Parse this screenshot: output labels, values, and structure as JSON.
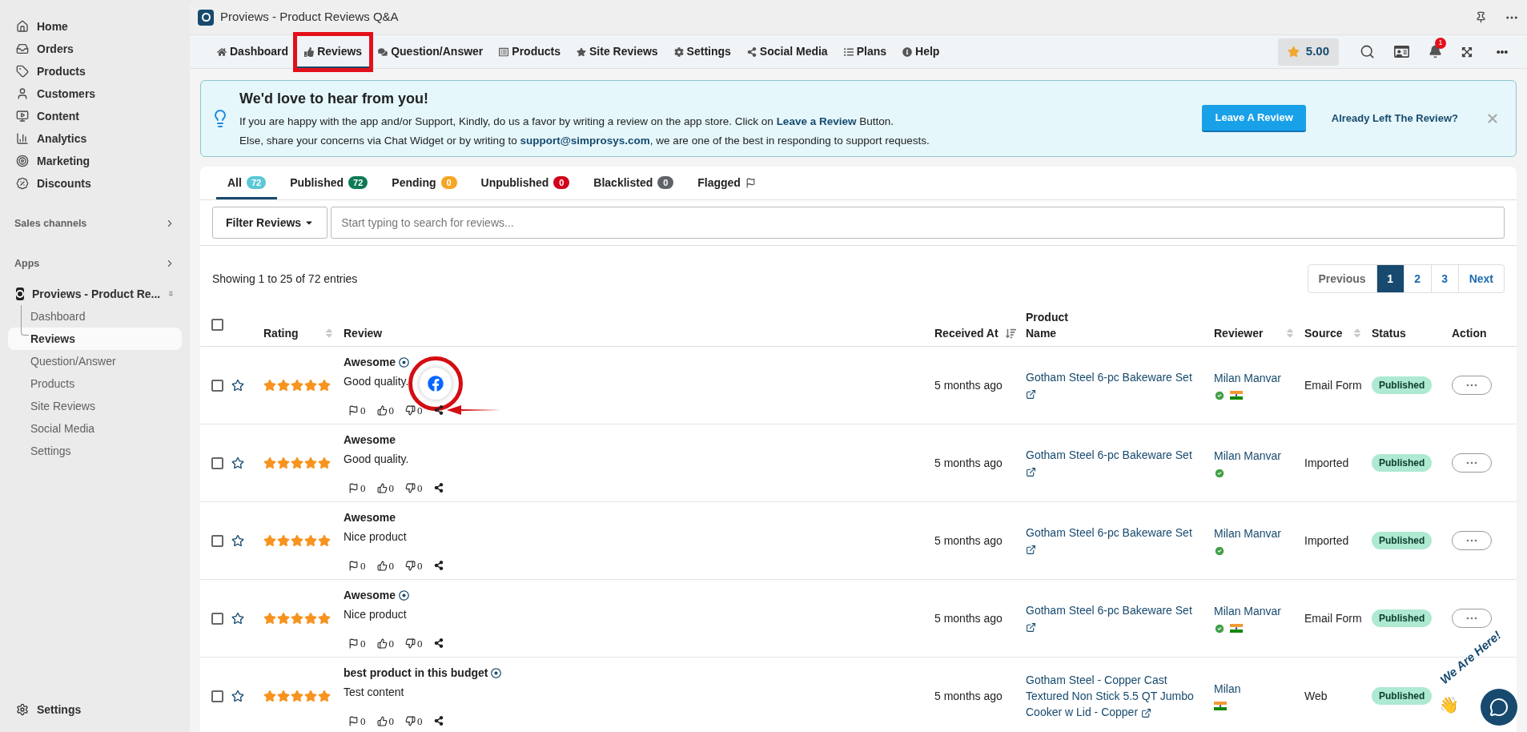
{
  "sidebar": {
    "items": [
      {
        "label": "Home"
      },
      {
        "label": "Orders"
      },
      {
        "label": "Products"
      },
      {
        "label": "Customers"
      },
      {
        "label": "Content"
      },
      {
        "label": "Analytics"
      },
      {
        "label": "Marketing"
      },
      {
        "label": "Discounts"
      }
    ],
    "sections": [
      {
        "label": "Sales channels"
      },
      {
        "label": "Apps"
      }
    ],
    "app": {
      "label": "Proviews - Product Re...",
      "children": [
        {
          "label": "Dashboard",
          "selected": false
        },
        {
          "label": "Reviews",
          "selected": true
        },
        {
          "label": "Question/Answer",
          "selected": false
        },
        {
          "label": "Products",
          "selected": false
        },
        {
          "label": "Site Reviews",
          "selected": false
        },
        {
          "label": "Social Media",
          "selected": false
        },
        {
          "label": "Settings",
          "selected": false
        }
      ]
    },
    "footer": {
      "label": "Settings"
    }
  },
  "window": {
    "title": "Proviews - Product Reviews Q&A"
  },
  "nav": {
    "tabs": [
      {
        "label": "Dashboard",
        "selected": false,
        "annotated": false
      },
      {
        "label": "Reviews",
        "selected": true,
        "annotated": true
      },
      {
        "label": "Question/Answer",
        "selected": false,
        "annotated": false
      },
      {
        "label": "Products",
        "selected": false,
        "annotated": false
      },
      {
        "label": "Site Reviews",
        "selected": false,
        "annotated": false
      },
      {
        "label": "Settings",
        "selected": false,
        "annotated": false
      },
      {
        "label": "Social Media",
        "selected": false,
        "annotated": false
      },
      {
        "label": "Plans",
        "selected": false,
        "annotated": false
      },
      {
        "label": "Help",
        "selected": false,
        "annotated": false
      }
    ],
    "rating": "5.00",
    "notifications": "1"
  },
  "banner": {
    "title": "We'd love to hear from you!",
    "lines": [
      "If you are happy with the app and/or Support, Kindly, do us a favor by writing a review on the app store. Click on **Leave a Review** Button.",
      "Else, share your concerns via Chat Widget or by writing to **support@simprosys.com**, we are one of the best in responding to support requests."
    ],
    "button": "Leave A Review",
    "link": "Already Left The Review?"
  },
  "status_tabs": [
    {
      "label": "All",
      "count": "72",
      "color": "#5bc8d6",
      "selected": true
    },
    {
      "label": "Published",
      "count": "72",
      "color": "#0f7a57",
      "selected": false
    },
    {
      "label": "Pending",
      "count": "0",
      "color": "#f5a623",
      "selected": false
    },
    {
      "label": "Unpublished",
      "count": "0",
      "color": "#d0021b",
      "selected": false
    },
    {
      "label": "Blacklisted",
      "count": "0",
      "color": "#5f6368",
      "selected": false
    },
    {
      "label": "Flagged",
      "selected": false
    }
  ],
  "filter": {
    "button": "Filter Reviews",
    "placeholder": "Start typing to search for reviews..."
  },
  "summary": "Showing 1 to 25 of 72 entries",
  "pagination": {
    "previous": "Previous",
    "next": "Next",
    "pages": [
      {
        "label": "1",
        "selected": true
      },
      {
        "label": "2",
        "selected": false
      },
      {
        "label": "3",
        "selected": false
      }
    ]
  },
  "table": {
    "select_all": {
      "checked": false
    },
    "columns": [
      {
        "label": "Rating",
        "sortable": true,
        "sorted": false
      },
      {
        "label": "Review",
        "sortable": false
      },
      {
        "label": "Received At",
        "sortable": true,
        "sorted": true
      },
      {
        "label": "Product Name",
        "sortable": false
      },
      {
        "label": "Reviewer",
        "sortable": true,
        "sorted": false
      },
      {
        "label": "Source",
        "sortable": true,
        "sorted": false
      },
      {
        "label": "Status",
        "sortable": false
      },
      {
        "label": "Action",
        "sortable": false
      }
    ],
    "rows": [
      {
        "checked": false,
        "favorite": false,
        "stars": 5,
        "title": "Awesome",
        "verified": true,
        "content": "Good quality.",
        "flags": "0",
        "likes": "0",
        "dislikes": "0",
        "share_popup": true,
        "received": "5 months ago",
        "product": "Gotham Steel 6-pc Bakeware Set",
        "reviewer": "Milan Manvar",
        "verified_buyer": true,
        "country_flag": true,
        "source": "Email Form",
        "status": "Published"
      },
      {
        "checked": false,
        "favorite": false,
        "stars": 5,
        "title": "Awesome",
        "verified": false,
        "content": "Good quality.",
        "flags": "0",
        "likes": "0",
        "dislikes": "0",
        "share_popup": false,
        "received": "5 months ago",
        "product": "Gotham Steel 6-pc Bakeware Set",
        "reviewer": "Milan Manvar",
        "verified_buyer": true,
        "country_flag": false,
        "source": "Imported",
        "status": "Published"
      },
      {
        "checked": false,
        "favorite": false,
        "stars": 5,
        "title": "Awesome",
        "verified": false,
        "content": "Nice product",
        "flags": "0",
        "likes": "0",
        "dislikes": "0",
        "share_popup": false,
        "received": "5 months ago",
        "product": "Gotham Steel 6-pc Bakeware Set",
        "reviewer": "Milan Manvar",
        "verified_buyer": true,
        "country_flag": false,
        "source": "Imported",
        "status": "Published"
      },
      {
        "checked": false,
        "favorite": false,
        "stars": 5,
        "title": "Awesome",
        "verified": true,
        "content": "Nice product",
        "flags": "0",
        "likes": "0",
        "dislikes": "0",
        "share_popup": false,
        "received": "5 months ago",
        "product": "Gotham Steel 6-pc Bakeware Set",
        "reviewer": "Milan Manvar",
        "verified_buyer": true,
        "country_flag": true,
        "source": "Email Form",
        "status": "Published"
      },
      {
        "checked": false,
        "favorite": false,
        "stars": 5,
        "title": "best product in this budget",
        "verified": true,
        "content": "Test content",
        "flags": "0",
        "likes": "0",
        "dislikes": "0",
        "share_popup": false,
        "received": "5 months ago",
        "product": "Gotham Steel - Copper Cast Textured Non Stick 5.5 QT Jumbo Cooker w Lid - Copper",
        "reviewer": "Milan",
        "verified_buyer": false,
        "country_flag": true,
        "source": "Web",
        "status": "Published",
        "action_menu": false
      }
    ]
  },
  "chat_widget": {
    "label": "We Are Here!",
    "emoji": "👋"
  }
}
